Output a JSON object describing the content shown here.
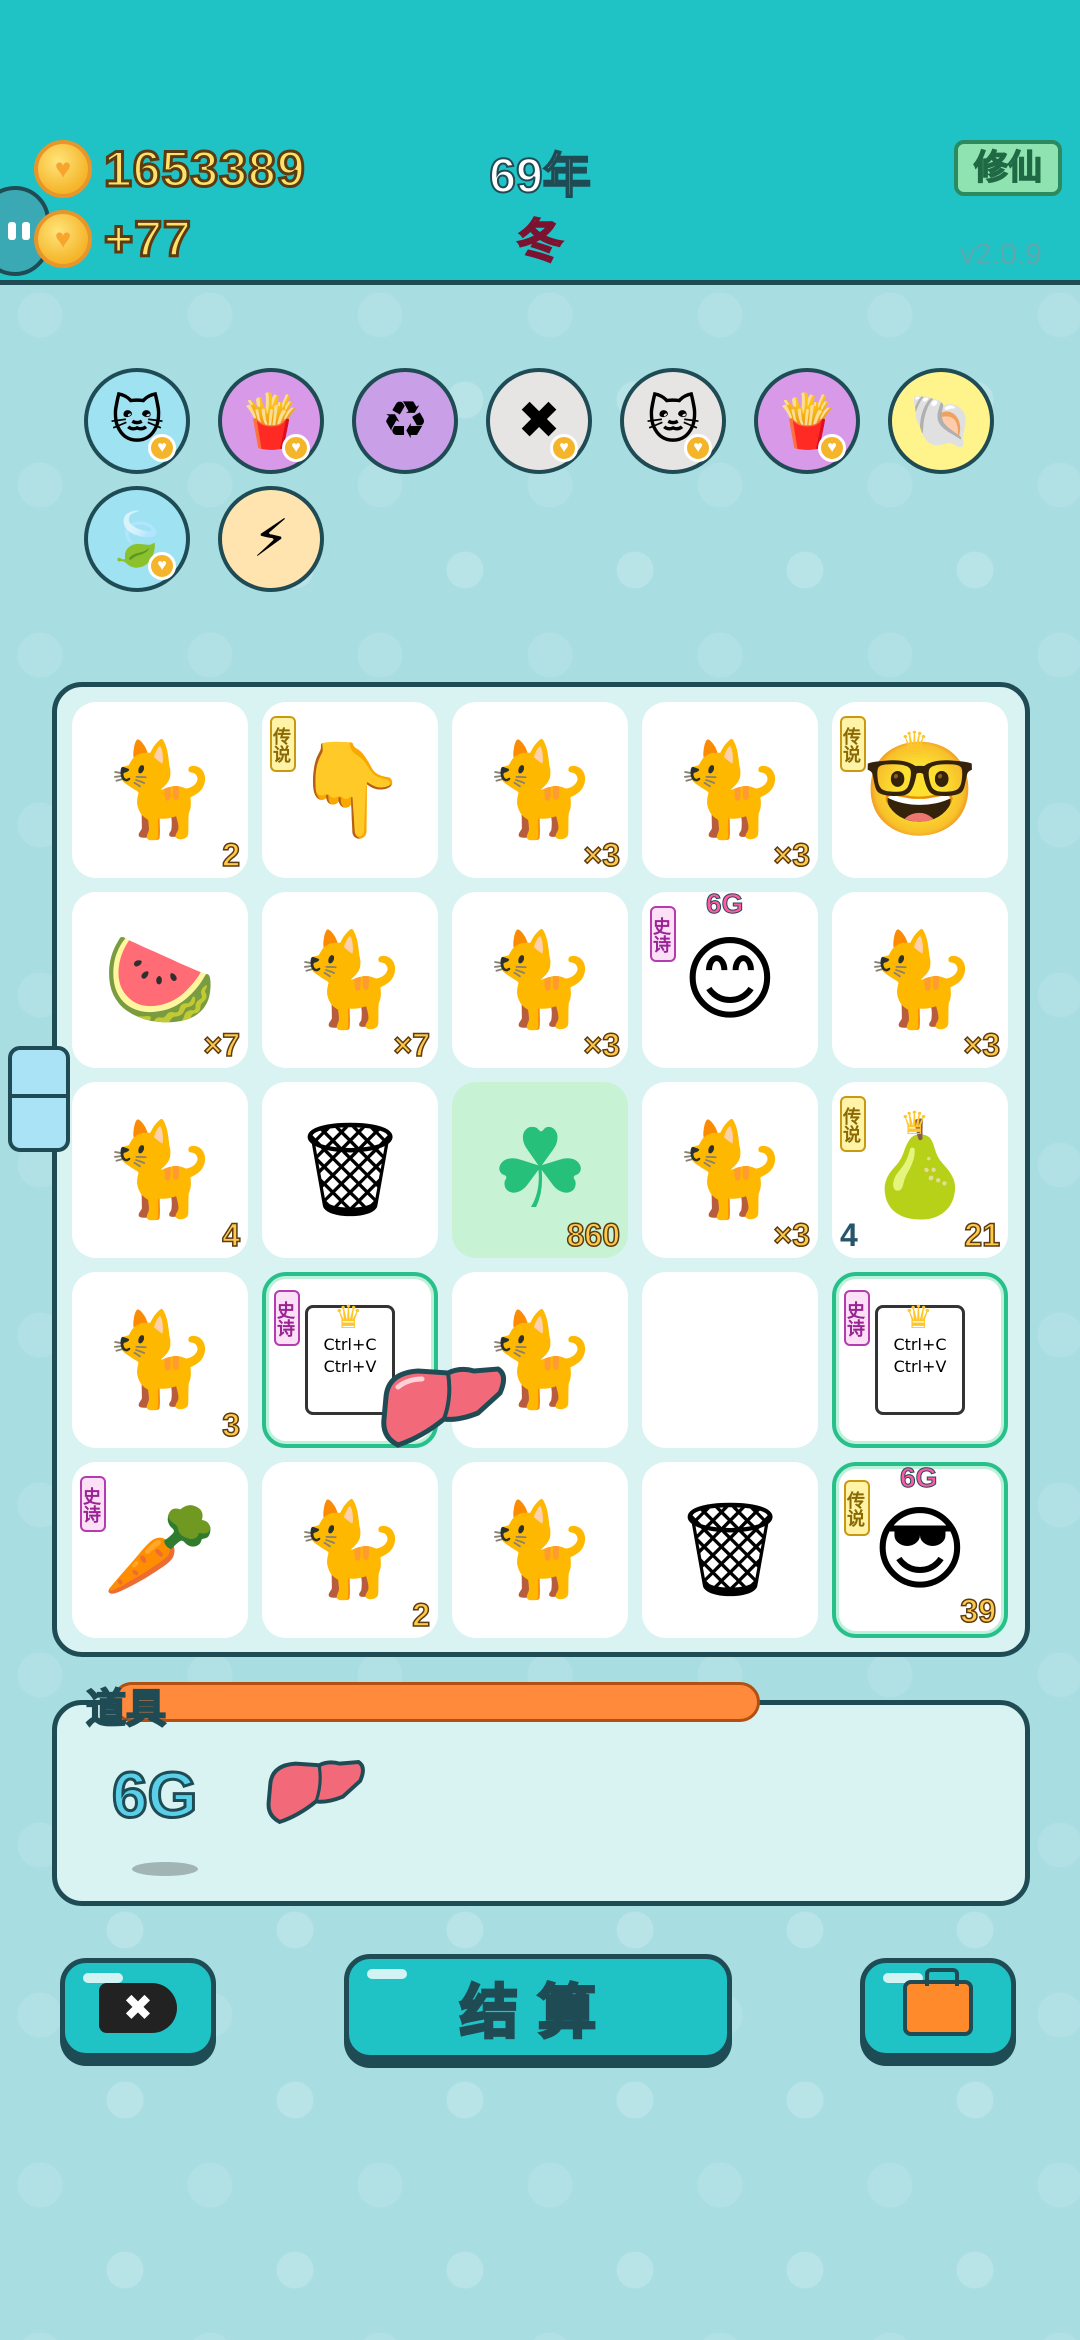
{
  "header": {
    "coins": "1653389",
    "income": "+77",
    "year": "69年",
    "season": "冬",
    "mode_button": "修仙",
    "version": "v2.0.9"
  },
  "skills": [
    {
      "icon": "cat-skill-icon",
      "color": "#9fe3f2",
      "glyph": "🐱",
      "badge": true
    },
    {
      "icon": "fries-skill-icon",
      "color": "#d89ae8",
      "glyph": "🍟",
      "badge": true
    },
    {
      "icon": "recycle-skill-icon",
      "color": "#c9a0e8",
      "glyph": "♻",
      "badge": false
    },
    {
      "icon": "delete-tag-skill-icon",
      "color": "#e7e4e4",
      "glyph": "✖",
      "badge": true
    },
    {
      "icon": "cats-coin-skill-icon",
      "color": "#e7e4e4",
      "glyph": "🐱",
      "badge": true
    },
    {
      "icon": "fries-skill-icon-2",
      "color": "#d89ae8",
      "glyph": "🍟",
      "badge": true
    },
    {
      "icon": "shell-skill-icon",
      "color": "#fff48c",
      "glyph": "🐚",
      "badge": false
    },
    {
      "icon": "leaf-skill-icon",
      "color": "#9fe3f2",
      "glyph": "🍃",
      "badge": true
    },
    {
      "icon": "lightning-skill-icon",
      "color": "#ffe4b0",
      "glyph": "⚡",
      "badge": false
    }
  ],
  "board": {
    "cells": [
      {
        "icon": "cat-icon",
        "glyph": "🐈",
        "count": "2"
      },
      {
        "icon": "pointing-hand-icon",
        "glyph": "👇",
        "count": "",
        "tag": "传说",
        "tagType": "legend"
      },
      {
        "icon": "cat-icon",
        "glyph": "🐈",
        "count": "×3"
      },
      {
        "icon": "cat-icon",
        "glyph": "🐈",
        "count": "×3"
      },
      {
        "icon": "king-face-icon",
        "glyph": "🤓",
        "count": "",
        "tag": "传说",
        "tagType": "legend",
        "crown": true
      },
      {
        "icon": "watermelon-icon",
        "glyph": "🍉",
        "count": "×7"
      },
      {
        "icon": "cat-icon",
        "glyph": "🐈",
        "count": "×7"
      },
      {
        "icon": "cat-icon",
        "glyph": "🐈",
        "count": "×3"
      },
      {
        "icon": "red-hat-face-icon",
        "glyph": "😊",
        "count": "",
        "tag": "史诗",
        "tagType": "epic",
        "top": "6G"
      },
      {
        "icon": "cat-icon",
        "glyph": "🐈",
        "count": "×3"
      },
      {
        "icon": "cat-icon",
        "glyph": "🐈",
        "count": "4"
      },
      {
        "icon": "trash-bag-icon",
        "glyph": "🗑",
        "count": ""
      },
      {
        "icon": "clover-pile-icon",
        "glyph": "☘",
        "count": "860",
        "green": true
      },
      {
        "icon": "cat-icon",
        "glyph": "🐈",
        "count": "×3"
      },
      {
        "icon": "golden-pear-icon",
        "glyph": "🍐",
        "count": "21",
        "lcount": "4",
        "tag": "传说",
        "tagType": "legend",
        "crown": true
      },
      {
        "icon": "cat-icon",
        "glyph": "🐈",
        "count": "3"
      },
      {
        "icon": "copy-paste-icon",
        "glyph": "ctrl",
        "count": "",
        "tag": "史诗",
        "tagType": "epic",
        "crown": true,
        "glow": true
      },
      {
        "icon": "cat-icon",
        "glyph": "🐈",
        "count": ""
      },
      {
        "icon": "empty-cell",
        "glyph": "",
        "count": ""
      },
      {
        "icon": "copy-paste-icon",
        "glyph": "ctrl",
        "count": "",
        "tag": "史诗",
        "tagType": "epic",
        "crown": true,
        "glow": true
      },
      {
        "icon": "carrot-icon",
        "glyph": "🥕",
        "count": "",
        "tag": "史诗",
        "tagType": "epic"
      },
      {
        "icon": "cat-icon",
        "glyph": "🐈",
        "count": "2"
      },
      {
        "icon": "cat-icon",
        "glyph": "🐈",
        "count": ""
      },
      {
        "icon": "trash-bag-icon",
        "glyph": "🗑",
        "count": ""
      },
      {
        "icon": "sunglasses-man-icon",
        "glyph": "😎",
        "count": "39",
        "tag": "传说",
        "tagType": "legend",
        "top": "6G",
        "glow": true
      }
    ],
    "ctrl_text": "Ctrl+C\nCtrl+V"
  },
  "items": {
    "title": "道具",
    "list": [
      {
        "icon": "6g-item-icon",
        "label": "6G"
      },
      {
        "icon": "liver-item-icon",
        "label": ""
      }
    ]
  },
  "buttons": {
    "remove": "✖",
    "settle": "结算",
    "bag": ""
  },
  "colors": {
    "header_bg": "#1fc3c6",
    "outline": "#1f4b55",
    "accent_orange": "#ff8a3c"
  }
}
